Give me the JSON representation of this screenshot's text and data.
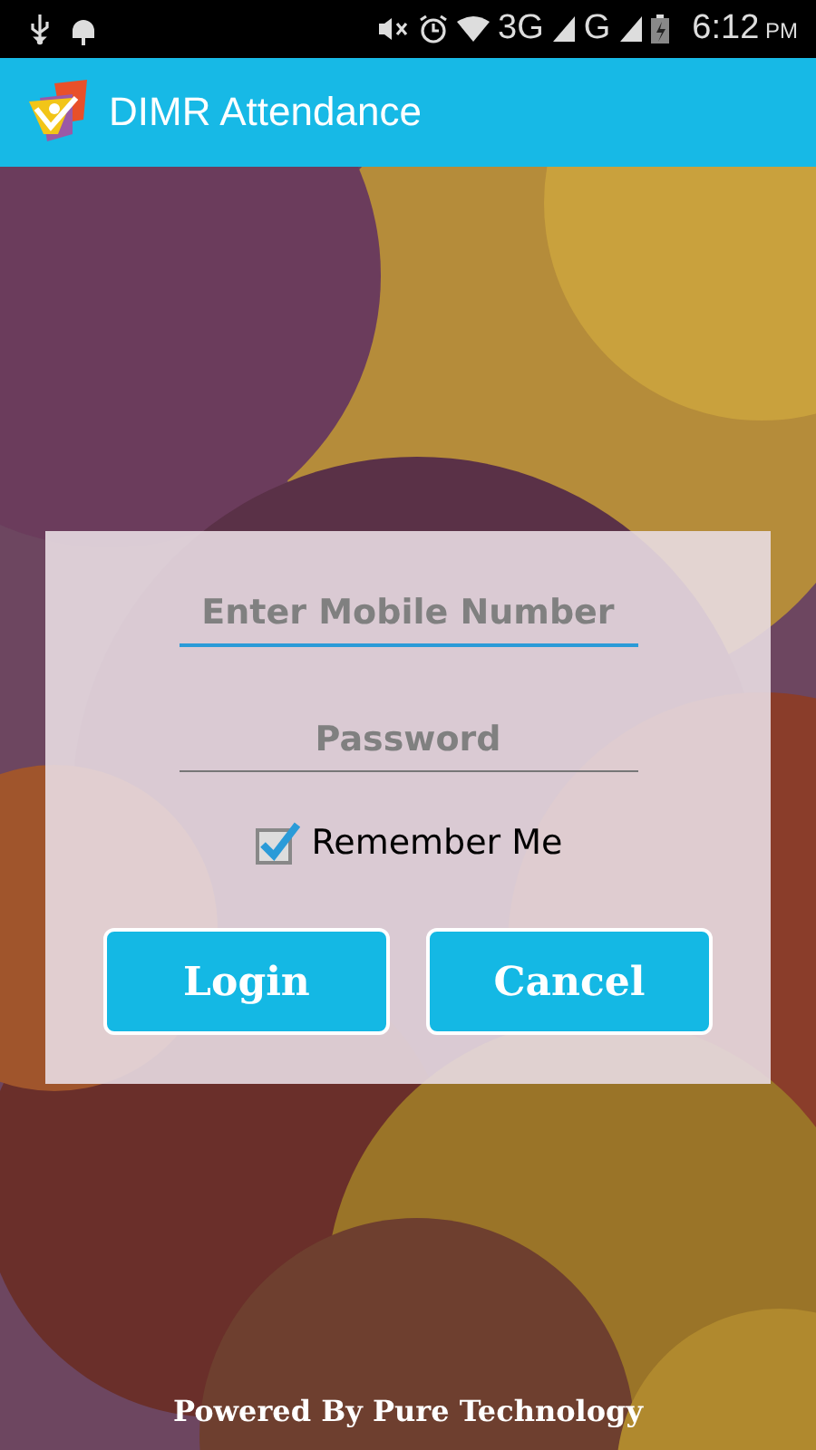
{
  "status_bar": {
    "network_1": "3G",
    "network_2": "G",
    "time": "6:12",
    "ampm": "PM"
  },
  "app_bar": {
    "title": "DIMR Attendance"
  },
  "login_form": {
    "mobile": {
      "placeholder": "Enter Mobile Number",
      "focused": true
    },
    "password": {
      "placeholder": "Password",
      "focused": false
    },
    "remember": {
      "label": "Remember Me",
      "checked": true
    },
    "buttons": [
      "Login",
      "Cancel"
    ]
  },
  "footer": "Powered By Pure Technology"
}
